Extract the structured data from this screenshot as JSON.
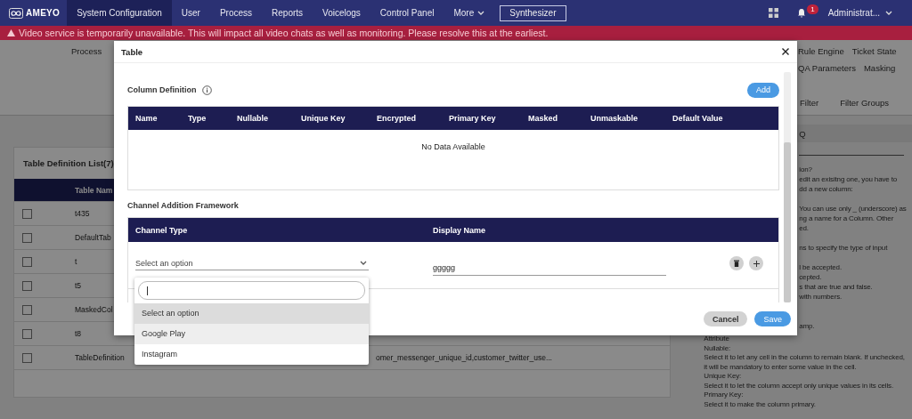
{
  "nav": {
    "logo": "AMEYO",
    "tabs": [
      {
        "label": "System Configuration",
        "selected": true,
        "kind": "link"
      },
      {
        "label": "User",
        "selected": false,
        "kind": "link"
      },
      {
        "label": "Process",
        "selected": false,
        "kind": "link"
      },
      {
        "label": "Reports",
        "selected": false,
        "kind": "link"
      },
      {
        "label": "Voicelogs",
        "selected": false,
        "kind": "link"
      },
      {
        "label": "Control Panel",
        "selected": false,
        "kind": "link"
      },
      {
        "label": "More",
        "selected": false,
        "kind": "menu"
      }
    ],
    "button": "Synthesizer",
    "notification_count": "1",
    "user": "Administrat..."
  },
  "banner": {
    "message": "Video service is temporarily unavailable. This will impact all video chats as well as monitoring. Please resolve this at the earliest."
  },
  "subnav": {
    "left": [
      "Process"
    ],
    "right_rows": [
      {
        "items": [
          "Rule Engine",
          "Ticket State"
        ]
      },
      {
        "items": [
          "QA Parameters",
          "Masking"
        ]
      },
      {
        "items": [
          "Filter",
          "Filter Groups"
        ]
      }
    ]
  },
  "table_list": {
    "title": "Table Definition List(7)",
    "columns": [
      "Table Nam"
    ],
    "rows": [
      {
        "checked": false,
        "name": "t435"
      },
      {
        "checked": false,
        "name": "DefaultTab"
      },
      {
        "checked": false,
        "name": "t"
      },
      {
        "checked": false,
        "name": "t5"
      },
      {
        "checked": false,
        "name": "MaskedCol"
      },
      {
        "checked": false,
        "name": "t8"
      },
      {
        "checked": false,
        "name": "TableDefinition",
        "column_3": "omer_messenger_unique_id,customer_twitter_use..."
      }
    ]
  },
  "faq": {
    "header": "Q",
    "partial_paragraphs": [
      {
        "lines": [
          "ion?",
          "edit an exisitng one, you have to",
          "dd a new column:"
        ]
      },
      {
        "lines": [
          "You can use only _ (underscore) as",
          "ng a name for a Column. Other",
          "ed."
        ]
      },
      {
        "lines": [
          "ns to specify the type of input"
        ]
      },
      {
        "lines": [
          "l be accepted.",
          "cepted.",
          "s that are true and false.",
          "with numbers."
        ]
      },
      {
        "lines": [
          "amp."
        ]
      }
    ],
    "entries": [
      "Attribute",
      "Nullable:",
      "Select it to let any cell in the column to remain blank. If unchecked, it will be mandatory to enter some value in the cell.",
      "Unique Key:",
      "Select it to let the column accept only unique values in its cells.",
      "Primary Key:",
      "Select it to make the column primary."
    ]
  },
  "modal": {
    "title": "Table",
    "column_definition": {
      "title": "Column Definition",
      "add_button": "Add",
      "columns": [
        "Name",
        "Type",
        "Nullable",
        "Unique Key",
        "Encrypted",
        "Primary Key",
        "Masked",
        "Unmaskable",
        "Default Value"
      ],
      "empty_text": "No Data Available"
    },
    "channel_framework": {
      "title": "Channel Addition Framework",
      "columns": [
        "Channel Type",
        "Display Name"
      ],
      "rows": [
        {
          "channel_type": "Select an option",
          "display_name": "ggggg"
        }
      ]
    },
    "dropdown": {
      "options": [
        {
          "label": "Select an option",
          "selected": true,
          "highlighted": false
        },
        {
          "label": "Google Play",
          "selected": false,
          "highlighted": true
        },
        {
          "label": "Instagram",
          "selected": false,
          "highlighted": false
        }
      ]
    },
    "buttons": [
      {
        "label": "Cancel",
        "kind": "secondary"
      },
      {
        "label": "Save",
        "kind": "primary"
      }
    ]
  }
}
